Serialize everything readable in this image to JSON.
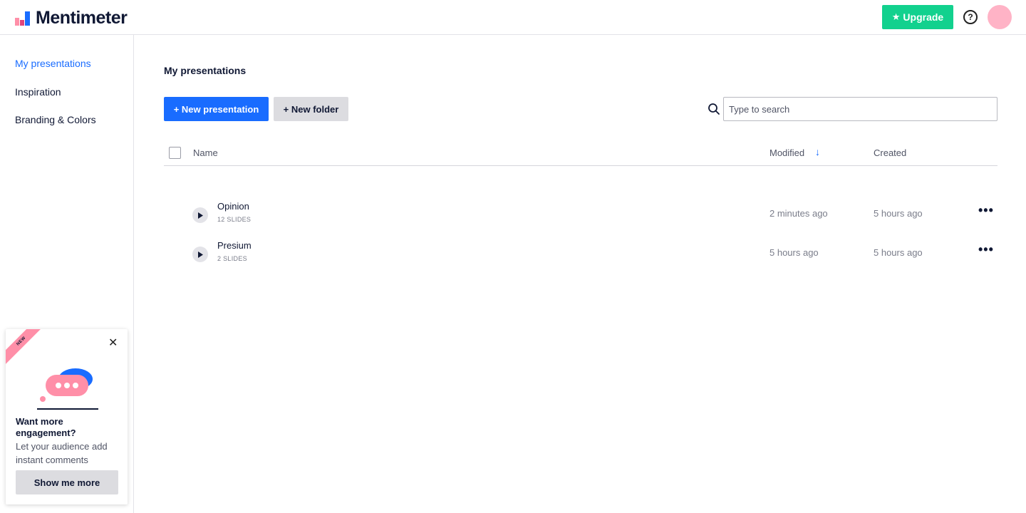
{
  "header": {
    "brand": "Mentimeter",
    "upgrade_label": "Upgrade",
    "help_glyph": "?"
  },
  "sidebar": {
    "items": [
      {
        "label": "My presentations",
        "active": true
      },
      {
        "label": "Inspiration",
        "active": false
      },
      {
        "label": "Branding & Colors",
        "active": false
      }
    ]
  },
  "promo": {
    "ribbon": "NEW",
    "title": "Want more engagement?",
    "body": "Let your audience add instant comments",
    "button_label": "Show me more"
  },
  "main": {
    "title": "My presentations",
    "new_presentation_label": "+ New presentation",
    "new_folder_label": "+ New folder",
    "search_placeholder": "Type to search",
    "columns": {
      "name": "Name",
      "modified": "Modified",
      "created": "Created"
    },
    "rows": [
      {
        "title": "Opinion",
        "slides": "12 SLIDES",
        "modified": "2 minutes ago",
        "created": "5 hours ago"
      },
      {
        "title": "Presium",
        "slides": "2 SLIDES",
        "modified": "5 hours ago",
        "created": "5 hours ago"
      }
    ]
  },
  "colors": {
    "primary": "#196cff",
    "upgrade": "#12d18e",
    "avatar": "#ffb3c6",
    "ribbon": "#ff8fa8"
  },
  "icons": {
    "logo": "mentimeter-logo-icon",
    "upgrade": "star-icon",
    "help": "help-circle-icon",
    "search": "search-icon",
    "sort": "arrow-down-icon",
    "play": "play-icon",
    "menu": "more-horizontal-icon",
    "close": "close-icon"
  }
}
